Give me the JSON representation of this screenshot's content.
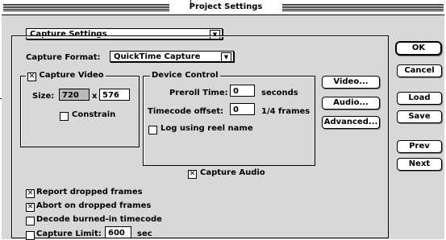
{
  "window": {
    "title": "Project Settings"
  },
  "top_popup": {
    "value": "Capture Settings"
  },
  "capture_format": {
    "label": "Capture Format:",
    "value": "QuickTime Capture"
  },
  "capture_video": {
    "label": "Capture Video",
    "checked": true,
    "size_label": "Size:",
    "width": "720",
    "x_label": "x",
    "height": "576",
    "constrain_label": "Constrain",
    "constrain_checked": false
  },
  "device_control": {
    "label": "Device Control",
    "preroll_label": "Preroll Time:",
    "preroll_value": "0",
    "preroll_unit": "seconds",
    "timecode_label": "Timecode offset:",
    "timecode_value": "0",
    "timecode_unit": "1/4 frames",
    "reel_label": "Log using reel name",
    "reel_checked": false
  },
  "side_buttons": {
    "video": "Video...",
    "audio": "Audio...",
    "advanced": "Advanced..."
  },
  "capture_audio": {
    "label": "Capture Audio",
    "checked": true
  },
  "options": {
    "report_dropped": {
      "label": "Report dropped frames",
      "checked": true
    },
    "abort_dropped": {
      "label": "Abort on dropped frames",
      "checked": true
    },
    "decode_timecode": {
      "label": "Decode burned-in timecode",
      "checked": false
    },
    "capture_limit": {
      "label": "Capture Limit:",
      "checked": false,
      "value": "600",
      "unit": "sec"
    }
  },
  "buttons": {
    "ok": "OK",
    "cancel": "Cancel",
    "load": "Load",
    "save": "Save",
    "prev": "Prev",
    "next": "Next"
  },
  "marks": {
    "checked": "✕",
    "unchecked": "",
    "popup_arrow": "▼"
  }
}
